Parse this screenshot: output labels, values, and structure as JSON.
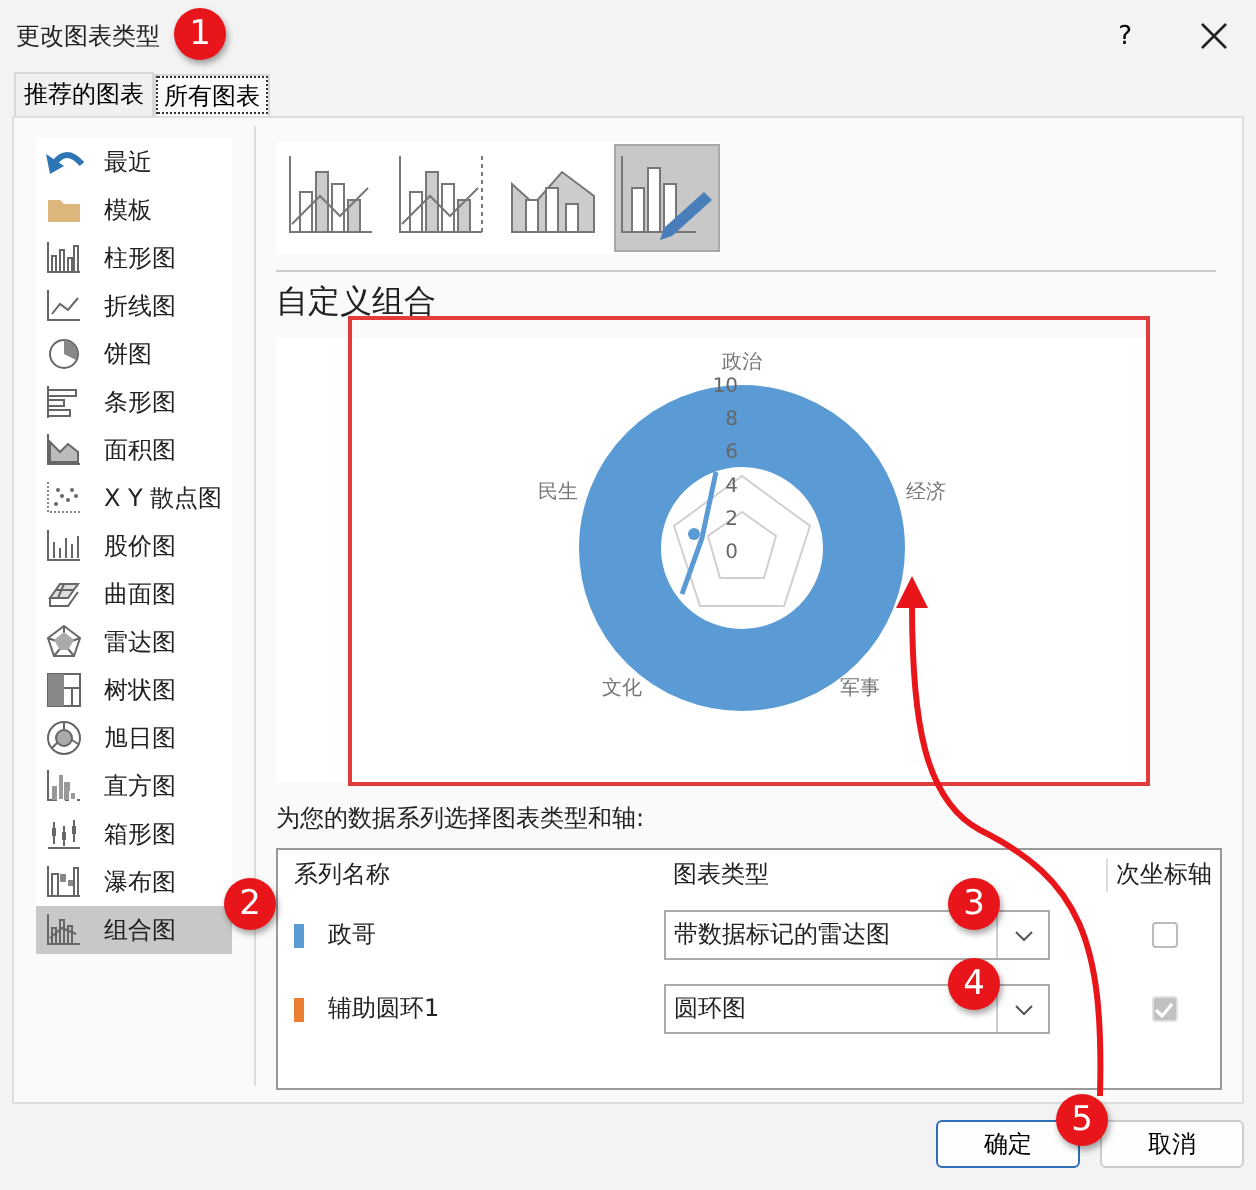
{
  "window": {
    "title": "更改图表类型",
    "help": "?"
  },
  "tabs": [
    {
      "label": "推荐的图表",
      "selected": false
    },
    {
      "label": "所有图表",
      "selected": true
    }
  ],
  "sidebar": {
    "items": [
      {
        "label": "最近",
        "selected": false
      },
      {
        "label": "模板",
        "selected": false
      },
      {
        "label": "柱形图",
        "selected": false
      },
      {
        "label": "折线图",
        "selected": false
      },
      {
        "label": "饼图",
        "selected": false
      },
      {
        "label": "条形图",
        "selected": false
      },
      {
        "label": "面积图",
        "selected": false
      },
      {
        "label": "X Y 散点图",
        "selected": false
      },
      {
        "label": "股价图",
        "selected": false
      },
      {
        "label": "曲面图",
        "selected": false
      },
      {
        "label": "雷达图",
        "selected": false
      },
      {
        "label": "树状图",
        "selected": false
      },
      {
        "label": "旭日图",
        "selected": false
      },
      {
        "label": "直方图",
        "selected": false
      },
      {
        "label": "箱形图",
        "selected": false
      },
      {
        "label": "瀑布图",
        "selected": false
      },
      {
        "label": "组合图",
        "selected": true
      }
    ]
  },
  "subtypes": [
    {
      "selected": false
    },
    {
      "selected": false
    },
    {
      "selected": false
    },
    {
      "selected": true
    }
  ],
  "heading": "自定义组合",
  "preview": {
    "axis_labels": [
      "政治",
      "经济",
      "军事",
      "文化",
      "民生"
    ],
    "ticks": [
      "10",
      "8",
      "6",
      "4",
      "2",
      "0"
    ]
  },
  "series_prompt": "为您的数据系列选择图表类型和轴:",
  "table": {
    "columns": [
      "系列名称",
      "图表类型",
      "次坐标轴"
    ],
    "rows": [
      {
        "name": "政哥",
        "color": "#5b9bd5",
        "chart_type": "带数据标记的雷达图",
        "secondary_axis": {
          "checked": false,
          "disabled": false
        }
      },
      {
        "name": "辅助圆环1",
        "color": "#ed7d31",
        "chart_type": "圆环图",
        "secondary_axis": {
          "checked": true,
          "disabled": true
        }
      }
    ]
  },
  "buttons": [
    "确定",
    "取消"
  ],
  "annotations": [
    {
      "label": "1"
    },
    {
      "label": "2"
    },
    {
      "label": "3"
    },
    {
      "label": "4"
    },
    {
      "label": "5"
    }
  ]
}
